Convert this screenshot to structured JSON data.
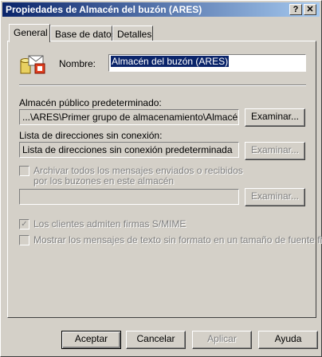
{
  "window": {
    "title": "Propiedades de Almacén del buzón (ARES)",
    "help_btn": "?",
    "close_btn": "✕"
  },
  "tabs": [
    {
      "label": "General"
    },
    {
      "label": "Base de datos"
    },
    {
      "label": "Detalles"
    }
  ],
  "general": {
    "name_label": "Nombre:",
    "name_value": "Almacén del buzón (ARES)",
    "public_store_label": "Almacén público predeterminado:",
    "public_store_value": "...\\ARES\\Primer grupo de almacenamiento\\Almacén de",
    "browse_label": "Examinar...",
    "offline_list_label": "Lista de direcciones sin conexión:",
    "offline_list_value": "Lista de direcciones sin conexión predeterminada",
    "archive_label_1": "Archivar todos los mensajes enviados o recibidos",
    "archive_label_2": "por los buzones en este almacén",
    "archive_value": "",
    "smime_label": "Los clientes admiten firmas S/MIME",
    "plaintext_label": "Mostrar los mensajes de texto sin formato en un tamaño de fuente fijo"
  },
  "buttons": {
    "ok": "Aceptar",
    "cancel": "Cancelar",
    "apply": "Aplicar",
    "help": "Ayuda"
  }
}
